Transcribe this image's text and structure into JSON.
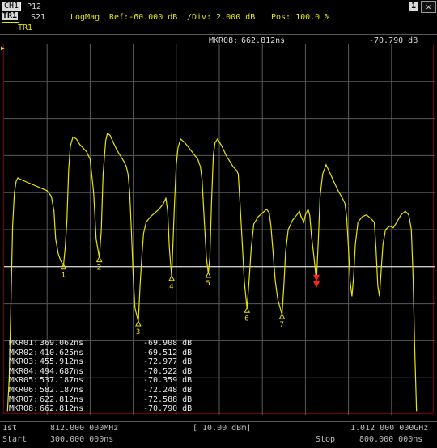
{
  "header": {
    "channel": "CH1",
    "param": "P12",
    "trace_badge": "TR1",
    "s_param": "S21",
    "format": "LogMag",
    "ref": "Ref:-60.000 dB",
    "div": "/Div:  2.000 dB",
    "pos": "Pos: 100.0 %",
    "trace_label": "TR1",
    "window_number": "1",
    "close_glyph": "×"
  },
  "active_marker": {
    "name": "MKR08:",
    "time": "662.812ns",
    "value": "-70.790 dB"
  },
  "markers": [
    {
      "name": "MKR01:",
      "time": "369.062ns",
      "value": "-69.908 dB",
      "label": "1"
    },
    {
      "name": "MKR02:",
      "time": "410.625ns",
      "value": "-69.512 dB",
      "label": "2"
    },
    {
      "name": "MKR03:",
      "time": "455.912ns",
      "value": "-72.977 dB",
      "label": "3"
    },
    {
      "name": "MKR04:",
      "time": "494.687ns",
      "value": "-70.522 dB",
      "label": "4"
    },
    {
      "name": "MKR05:",
      "time": "537.187ns",
      "value": "-70.359 dB",
      "label": "5"
    },
    {
      "name": "MKR06:",
      "time": "582.187ns",
      "value": "-72.248 dB",
      "label": "6"
    },
    {
      "name": "MKR07:",
      "time": "622.812ns",
      "value": "-72.588 dB",
      "label": "7"
    },
    {
      "name": "MKR08:",
      "time": "662.812ns",
      "value": "-70.790 dB",
      "label": ""
    }
  ],
  "footer": {
    "row1_left_label": "1st",
    "row1_freq": "812.000 000MHz",
    "row1_power": "[ 10.00 dBm]",
    "row1_right": "1.012 000 000GHz",
    "row2_left_label": "Start",
    "row2_start": "300.000 000ns",
    "row2_stop_label": "Stop",
    "row2_stop": "800.000 000ns"
  },
  "colors": {
    "trace": "#e6e600",
    "grid": "#5a5a5a",
    "ref_line": "#ffffff",
    "border": "#7a0000",
    "active_marker": "#ff2020"
  },
  "chart_data": {
    "type": "line",
    "xlim": [
      300,
      800
    ],
    "ylim": [
      -78,
      -58
    ],
    "trace": [
      [
        304,
        -77.8
      ],
      [
        306,
        -76
      ],
      [
        308,
        -72
      ],
      [
        310,
        -67.8
      ],
      [
        312,
        -66
      ],
      [
        314,
        -65.4
      ],
      [
        316,
        -65.2
      ],
      [
        320,
        -65.3
      ],
      [
        325,
        -65.4
      ],
      [
        330,
        -65.5
      ],
      [
        335,
        -65.6
      ],
      [
        340,
        -65.7
      ],
      [
        345,
        -65.8
      ],
      [
        350,
        -65.9
      ],
      [
        355,
        -66.2
      ],
      [
        358,
        -67
      ],
      [
        360,
        -68.5
      ],
      [
        363,
        -69.3
      ],
      [
        366,
        -69.7
      ],
      [
        369.062,
        -69.908
      ],
      [
        371,
        -69
      ],
      [
        373,
        -67.5
      ],
      [
        375,
        -64.8
      ],
      [
        377,
        -63.5
      ],
      [
        380,
        -63.0
      ],
      [
        384,
        -63.1
      ],
      [
        388,
        -63.4
      ],
      [
        392,
        -63.6
      ],
      [
        396,
        -63.8
      ],
      [
        400,
        -64.2
      ],
      [
        404,
        -66
      ],
      [
        407,
        -68.5
      ],
      [
        410.625,
        -69.512
      ],
      [
        413,
        -68
      ],
      [
        415,
        -65
      ],
      [
        418,
        -63.2
      ],
      [
        420,
        -62.8
      ],
      [
        423,
        -62.9
      ],
      [
        427,
        -63.3
      ],
      [
        431,
        -63.7
      ],
      [
        435,
        -64.0
      ],
      [
        439,
        -64.3
      ],
      [
        442,
        -64.6
      ],
      [
        444,
        -65.0
      ],
      [
        446,
        -66.0
      ],
      [
        448,
        -68.2
      ],
      [
        450,
        -70.5
      ],
      [
        452,
        -72.2
      ],
      [
        455.912,
        -72.977
      ],
      [
        458,
        -71
      ],
      [
        460,
        -69.5
      ],
      [
        462,
        -68.2
      ],
      [
        465,
        -67.6
      ],
      [
        470,
        -67.3
      ],
      [
        475,
        -67.1
      ],
      [
        480,
        -66.9
      ],
      [
        485,
        -66.6
      ],
      [
        488,
        -66.3
      ],
      [
        490,
        -67
      ],
      [
        492,
        -69
      ],
      [
        494.687,
        -70.522
      ],
      [
        496,
        -69
      ],
      [
        498,
        -66.5
      ],
      [
        500,
        -64.5
      ],
      [
        502,
        -63.6
      ],
      [
        505,
        -63.1
      ],
      [
        510,
        -63.3
      ],
      [
        515,
        -63.6
      ],
      [
        520,
        -63.9
      ],
      [
        525,
        -64.2
      ],
      [
        528,
        -64.6
      ],
      [
        530,
        -65.3
      ],
      [
        532,
        -67
      ],
      [
        535,
        -69.5
      ],
      [
        537.187,
        -70.359
      ],
      [
        539,
        -69.5
      ],
      [
        541,
        -66.5
      ],
      [
        543,
        -64
      ],
      [
        545,
        -63.3
      ],
      [
        548,
        -63.1
      ],
      [
        553,
        -63.5
      ],
      [
        558,
        -64.0
      ],
      [
        562,
        -64.3
      ],
      [
        566,
        -64.6
      ],
      [
        570,
        -64.8
      ],
      [
        572,
        -65.0
      ],
      [
        574,
        -66.5
      ],
      [
        577,
        -69
      ],
      [
        579,
        -70.8
      ],
      [
        582.187,
        -72.248
      ],
      [
        585,
        -70.5
      ],
      [
        587,
        -69
      ],
      [
        590,
        -67.7
      ],
      [
        595,
        -67.3
      ],
      [
        600,
        -67.1
      ],
      [
        605,
        -66.9
      ],
      [
        608,
        -67.1
      ],
      [
        610,
        -67.8
      ],
      [
        612,
        -69
      ],
      [
        615,
        -70.8
      ],
      [
        618,
        -71.8
      ],
      [
        622.812,
        -72.588
      ],
      [
        625,
        -71
      ],
      [
        627,
        -69.2
      ],
      [
        630,
        -68.0
      ],
      [
        635,
        -67.5
      ],
      [
        640,
        -67.2
      ],
      [
        643,
        -67.0
      ],
      [
        645,
        -67.3
      ],
      [
        648,
        -67.6
      ],
      [
        650,
        -67.2
      ],
      [
        653,
        -66.9
      ],
      [
        655,
        -67.2
      ],
      [
        657,
        -68.3
      ],
      [
        660,
        -69.5
      ],
      [
        662.812,
        -70.79
      ],
      [
        665,
        -68.5
      ],
      [
        667,
        -66.2
      ],
      [
        670,
        -65.0
      ],
      [
        674,
        -64.5
      ],
      [
        678,
        -64.9
      ],
      [
        683,
        -65.4
      ],
      [
        688,
        -65.9
      ],
      [
        693,
        -66.3
      ],
      [
        696,
        -66.6
      ],
      [
        698,
        -67.4
      ],
      [
        700,
        -69.0
      ],
      [
        702,
        -70.8
      ],
      [
        704,
        -71.6
      ],
      [
        706,
        -70.5
      ],
      [
        708,
        -68.8
      ],
      [
        711,
        -67.6
      ],
      [
        716,
        -67.3
      ],
      [
        721,
        -67.2
      ],
      [
        726,
        -67.4
      ],
      [
        730,
        -67.6
      ],
      [
        732,
        -69.0
      ],
      [
        734,
        -71.0
      ],
      [
        736,
        -71.6
      ],
      [
        738,
        -70.2
      ],
      [
        740,
        -68.8
      ],
      [
        743,
        -68.0
      ],
      [
        748,
        -67.8
      ],
      [
        752,
        -67.9
      ],
      [
        756,
        -67.6
      ],
      [
        761,
        -67.2
      ],
      [
        766,
        -67.0
      ],
      [
        770,
        -67.2
      ],
      [
        773,
        -68.0
      ],
      [
        775,
        -70.5
      ],
      [
        777,
        -74.5
      ],
      [
        779,
        -77.8
      ]
    ]
  }
}
